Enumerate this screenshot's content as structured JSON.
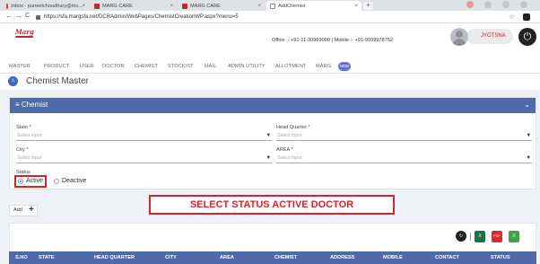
{
  "browser": {
    "tabs": [
      {
        "title": "Inbox - puneetchoudhary@mv..."
      },
      {
        "title": "MARG CARE"
      },
      {
        "title": "MARG CARE"
      },
      {
        "title": "AddChemist"
      }
    ],
    "nav": {
      "back": "←",
      "forward": "→",
      "reload": "C"
    },
    "url": "https://sfa.margsfa.net/DCRAdmin/WebPages/ChemistCreationWP.aspx?menu=5",
    "star": "☆"
  },
  "header": {
    "logo": "Marg",
    "contact": "Office :- +91-11-30969000  |  Mobile :- +91-9999978752",
    "user": "JYOTSNA",
    "power": "⏻"
  },
  "menu": {
    "items": [
      "MASTER",
      "PRODUCT",
      "USER",
      "DOCTOR",
      "CHEMIST",
      "STOCKIST",
      "MAIL",
      "ADMIN UTILITY",
      "ALLOTMENT",
      "MARG"
    ],
    "badge": "NEW"
  },
  "page": {
    "title": "Chemist Master",
    "home_icon": "⌂"
  },
  "form": {
    "panel_title": "≡ Chemist",
    "chevron": "⌄",
    "state_label": "State",
    "head_quarter_label": "Head Quarter",
    "city_label": "City",
    "area_label": "AREA",
    "required_mark": "*",
    "placeholder": "Select Input",
    "caret": "▼",
    "status_label": "Status",
    "status_active": "Active",
    "status_deactive": "Deactive"
  },
  "actions": {
    "add_label": "Add",
    "add_plus": "+"
  },
  "annotation": {
    "note": "SELECT STATUS ACTIVE DOCTOR"
  },
  "export": {
    "excel_label": "X",
    "pdf_label": "PDF",
    "csv_label": "X"
  },
  "table": {
    "columns": [
      "S.NO",
      "STATE",
      "HEAD QUARTER",
      "CITY",
      "AREA",
      "CHEMIST",
      "ADDRESS",
      "MOBILE",
      "CONTACT",
      "STATUS"
    ]
  },
  "colors": {
    "brand_red": "#c0262d",
    "accent_blue": "#4f6aa8",
    "highlight": "#d8232a"
  }
}
